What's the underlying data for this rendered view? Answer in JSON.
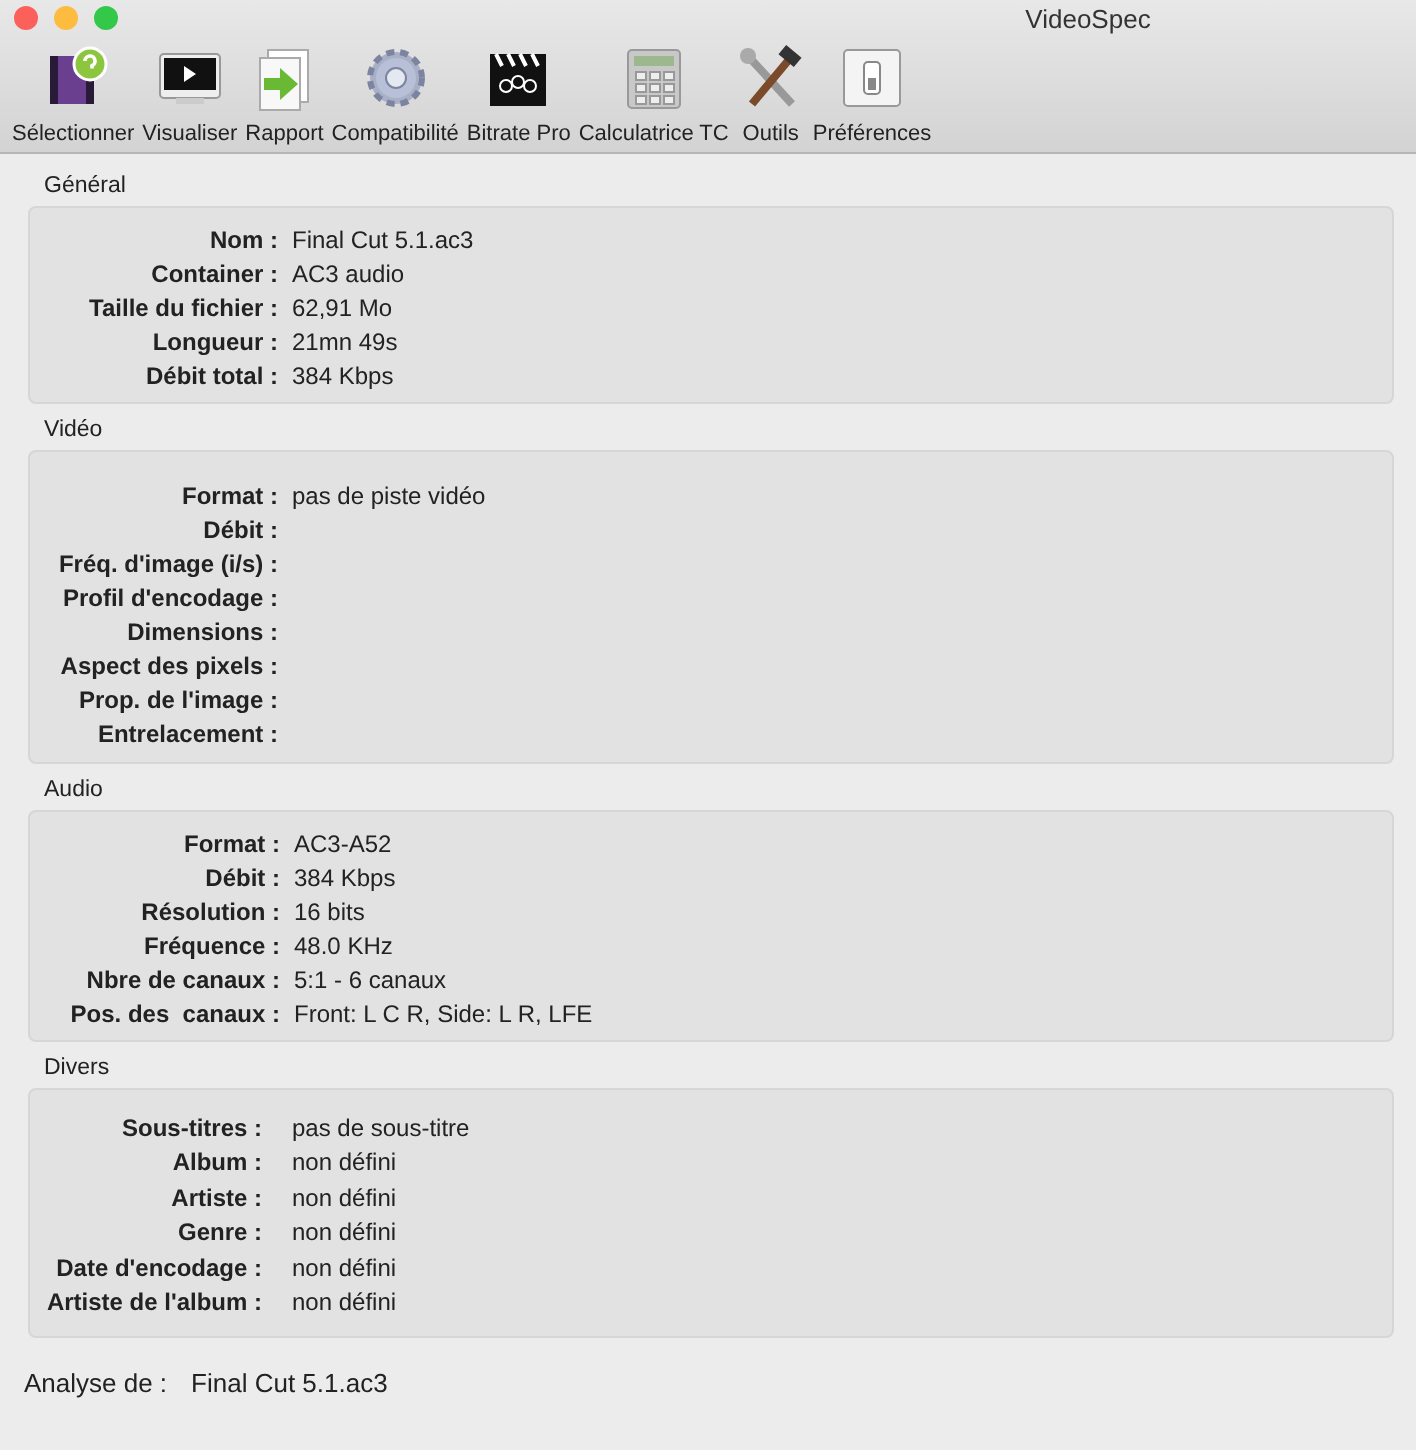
{
  "window": {
    "title": "VideoSpec"
  },
  "toolbar": [
    {
      "label": "Sélectionner"
    },
    {
      "label": "Visualiser"
    },
    {
      "label": "Rapport"
    },
    {
      "label": "Compatibilité"
    },
    {
      "label": "Bitrate Pro"
    },
    {
      "label": "Calculatrice TC"
    },
    {
      "label": "Outils"
    },
    {
      "label": "Préférences"
    }
  ],
  "sections": [
    {
      "title": "Général",
      "rows": [
        {
          "label": "Nom :",
          "value": "Final Cut 5.1.ac3"
        },
        {
          "label": "Container :",
          "value": "AC3 audio"
        },
        {
          "label": "Taille du fichier :",
          "value": "62,91 Mo"
        },
        {
          "label": "Longueur :",
          "value": "21mn 49s"
        },
        {
          "label": "Débit total :",
          "value": "384 Kbps"
        }
      ]
    },
    {
      "title": "Vidéo",
      "rows": [
        {
          "label": "Format :",
          "value": "pas de piste vidéo"
        },
        {
          "label": "Débit :"
        },
        {
          "label": "Fréq. d'image (i/s) :"
        },
        {
          "label": "Profil d'encodage :"
        },
        {
          "label": "Dimensions :"
        },
        {
          "label": "Aspect des pixels :"
        },
        {
          "label": "Prop. de l'image :"
        },
        {
          "label": "Entrelacement :"
        }
      ]
    },
    {
      "title": "Audio",
      "rows": [
        {
          "label": "Format :",
          "value": "AC3-A52"
        },
        {
          "label": "Débit :",
          "value": "384 Kbps"
        },
        {
          "label": "Résolution :",
          "value": "16 bits"
        },
        {
          "label": "Fréquence :",
          "value": "48.0 KHz"
        },
        {
          "label": "Nbre de canaux :",
          "value": "5:1 - 6 canaux"
        },
        {
          "label": "Pos. des  canaux :",
          "value": "Front: L C R, Side: L R, LFE"
        }
      ]
    },
    {
      "title": "Divers",
      "rows": [
        {
          "label": "Sous-titres :",
          "value": "pas de sous-titre"
        },
        {
          "label": "Album :",
          "value": "non défini"
        },
        {
          "label": "Artiste :",
          "value": "non défini"
        },
        {
          "label": "Genre :",
          "value": "non défini"
        },
        {
          "label": "Date d'encodage :",
          "value": "non défini"
        },
        {
          "label": "Artiste de l'album :",
          "value": "non défini"
        }
      ]
    }
  ],
  "footer": {
    "label": "Analyse de :",
    "value": "Final Cut 5.1.ac3"
  }
}
